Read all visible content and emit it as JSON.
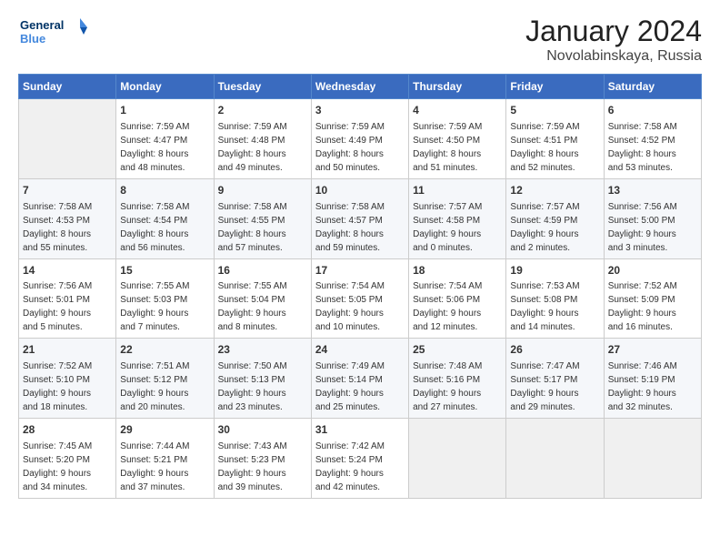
{
  "logo": {
    "line1": "General",
    "line2": "Blue"
  },
  "title": "January 2024",
  "subtitle": "Novolabinskaya, Russia",
  "weekdays": [
    "Sunday",
    "Monday",
    "Tuesday",
    "Wednesday",
    "Thursday",
    "Friday",
    "Saturday"
  ],
  "weeks": [
    [
      {
        "day": "",
        "info": ""
      },
      {
        "day": "1",
        "info": "Sunrise: 7:59 AM\nSunset: 4:47 PM\nDaylight: 8 hours\nand 48 minutes."
      },
      {
        "day": "2",
        "info": "Sunrise: 7:59 AM\nSunset: 4:48 PM\nDaylight: 8 hours\nand 49 minutes."
      },
      {
        "day": "3",
        "info": "Sunrise: 7:59 AM\nSunset: 4:49 PM\nDaylight: 8 hours\nand 50 minutes."
      },
      {
        "day": "4",
        "info": "Sunrise: 7:59 AM\nSunset: 4:50 PM\nDaylight: 8 hours\nand 51 minutes."
      },
      {
        "day": "5",
        "info": "Sunrise: 7:59 AM\nSunset: 4:51 PM\nDaylight: 8 hours\nand 52 minutes."
      },
      {
        "day": "6",
        "info": "Sunrise: 7:58 AM\nSunset: 4:52 PM\nDaylight: 8 hours\nand 53 minutes."
      }
    ],
    [
      {
        "day": "7",
        "info": "Sunrise: 7:58 AM\nSunset: 4:53 PM\nDaylight: 8 hours\nand 55 minutes."
      },
      {
        "day": "8",
        "info": "Sunrise: 7:58 AM\nSunset: 4:54 PM\nDaylight: 8 hours\nand 56 minutes."
      },
      {
        "day": "9",
        "info": "Sunrise: 7:58 AM\nSunset: 4:55 PM\nDaylight: 8 hours\nand 57 minutes."
      },
      {
        "day": "10",
        "info": "Sunrise: 7:58 AM\nSunset: 4:57 PM\nDaylight: 8 hours\nand 59 minutes."
      },
      {
        "day": "11",
        "info": "Sunrise: 7:57 AM\nSunset: 4:58 PM\nDaylight: 9 hours\nand 0 minutes."
      },
      {
        "day": "12",
        "info": "Sunrise: 7:57 AM\nSunset: 4:59 PM\nDaylight: 9 hours\nand 2 minutes."
      },
      {
        "day": "13",
        "info": "Sunrise: 7:56 AM\nSunset: 5:00 PM\nDaylight: 9 hours\nand 3 minutes."
      }
    ],
    [
      {
        "day": "14",
        "info": "Sunrise: 7:56 AM\nSunset: 5:01 PM\nDaylight: 9 hours\nand 5 minutes."
      },
      {
        "day": "15",
        "info": "Sunrise: 7:55 AM\nSunset: 5:03 PM\nDaylight: 9 hours\nand 7 minutes."
      },
      {
        "day": "16",
        "info": "Sunrise: 7:55 AM\nSunset: 5:04 PM\nDaylight: 9 hours\nand 8 minutes."
      },
      {
        "day": "17",
        "info": "Sunrise: 7:54 AM\nSunset: 5:05 PM\nDaylight: 9 hours\nand 10 minutes."
      },
      {
        "day": "18",
        "info": "Sunrise: 7:54 AM\nSunset: 5:06 PM\nDaylight: 9 hours\nand 12 minutes."
      },
      {
        "day": "19",
        "info": "Sunrise: 7:53 AM\nSunset: 5:08 PM\nDaylight: 9 hours\nand 14 minutes."
      },
      {
        "day": "20",
        "info": "Sunrise: 7:52 AM\nSunset: 5:09 PM\nDaylight: 9 hours\nand 16 minutes."
      }
    ],
    [
      {
        "day": "21",
        "info": "Sunrise: 7:52 AM\nSunset: 5:10 PM\nDaylight: 9 hours\nand 18 minutes."
      },
      {
        "day": "22",
        "info": "Sunrise: 7:51 AM\nSunset: 5:12 PM\nDaylight: 9 hours\nand 20 minutes."
      },
      {
        "day": "23",
        "info": "Sunrise: 7:50 AM\nSunset: 5:13 PM\nDaylight: 9 hours\nand 23 minutes."
      },
      {
        "day": "24",
        "info": "Sunrise: 7:49 AM\nSunset: 5:14 PM\nDaylight: 9 hours\nand 25 minutes."
      },
      {
        "day": "25",
        "info": "Sunrise: 7:48 AM\nSunset: 5:16 PM\nDaylight: 9 hours\nand 27 minutes."
      },
      {
        "day": "26",
        "info": "Sunrise: 7:47 AM\nSunset: 5:17 PM\nDaylight: 9 hours\nand 29 minutes."
      },
      {
        "day": "27",
        "info": "Sunrise: 7:46 AM\nSunset: 5:19 PM\nDaylight: 9 hours\nand 32 minutes."
      }
    ],
    [
      {
        "day": "28",
        "info": "Sunrise: 7:45 AM\nSunset: 5:20 PM\nDaylight: 9 hours\nand 34 minutes."
      },
      {
        "day": "29",
        "info": "Sunrise: 7:44 AM\nSunset: 5:21 PM\nDaylight: 9 hours\nand 37 minutes."
      },
      {
        "day": "30",
        "info": "Sunrise: 7:43 AM\nSunset: 5:23 PM\nDaylight: 9 hours\nand 39 minutes."
      },
      {
        "day": "31",
        "info": "Sunrise: 7:42 AM\nSunset: 5:24 PM\nDaylight: 9 hours\nand 42 minutes."
      },
      {
        "day": "",
        "info": ""
      },
      {
        "day": "",
        "info": ""
      },
      {
        "day": "",
        "info": ""
      }
    ]
  ]
}
